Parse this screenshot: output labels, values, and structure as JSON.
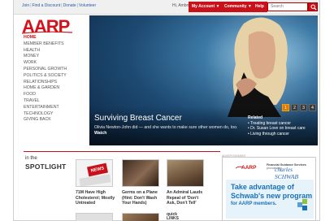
{
  "topbar": {
    "join_label": "Join",
    "find_discount_label": "Find a Discount",
    "donate_label": "Donate",
    "volunteer_label": "Volunteer",
    "separator": "|",
    "welcome_text": "Hi, Ambrose",
    "my_account_label": "My Account ▼",
    "community_label": "Community ▼",
    "help_label": "Help",
    "search_placeholder": "Search"
  },
  "logo": {
    "text": "AARP"
  },
  "nav": {
    "items": [
      {
        "label": "Home",
        "active": true
      },
      {
        "label": "Member Benefits"
      },
      {
        "label": "Health"
      },
      {
        "label": "Money"
      },
      {
        "label": "Work"
      },
      {
        "label": "Personal Growth"
      },
      {
        "label": "Politics & Society"
      },
      {
        "label": "Relationships"
      },
      {
        "label": "Home & Garden"
      },
      {
        "label": "Food"
      },
      {
        "label": "Travel"
      },
      {
        "label": "Entertainment"
      },
      {
        "label": "Technology"
      },
      {
        "label": "Giving Back"
      }
    ]
  },
  "hero": {
    "title": "Surviving Breast Cancer",
    "description": "Olivia Newton-John did — and she wants to make sure other women do, too.",
    "watch_label": "Watch",
    "related_heading": "Related",
    "related_items": [
      "Treating breast cancer",
      "Dr. Susan Love on breast care",
      "Living through cancer"
    ],
    "pages": [
      "1",
      "2",
      "3",
      "4"
    ],
    "active_page": "1"
  },
  "spotlight": {
    "in_the": "in the",
    "title": "SPOTLIGHT",
    "items": [
      {
        "caption": "71M Have High Cholesterol; Mostly Untreated",
        "thumb_badge": "NEWS"
      },
      {
        "caption": "Germs on a Plane (Hint: Don't Wash Your Hands)"
      },
      {
        "caption": "An Admiral Lauds Repeal of 'Don't Ask, Don't Tell'"
      }
    ],
    "quick_links_label": "quick LINKS"
  },
  "ad": {
    "label": "ADVERTISEMENT",
    "aarp": "AARP",
    "fgs_line1": "Financial Guidance Services",
    "fgs_line2": "provided by",
    "schwab": "charles SCHWAB",
    "headline1": "Take advantage of",
    "headline2": "Schwab's new program",
    "subline": "for AARP members."
  },
  "colors": {
    "brand_red": "#c8111a",
    "logo_red": "#d4121b",
    "link_blue": "#2a5aa6",
    "active_page": "#e07a00",
    "ad_blue": "#1a70b8"
  }
}
